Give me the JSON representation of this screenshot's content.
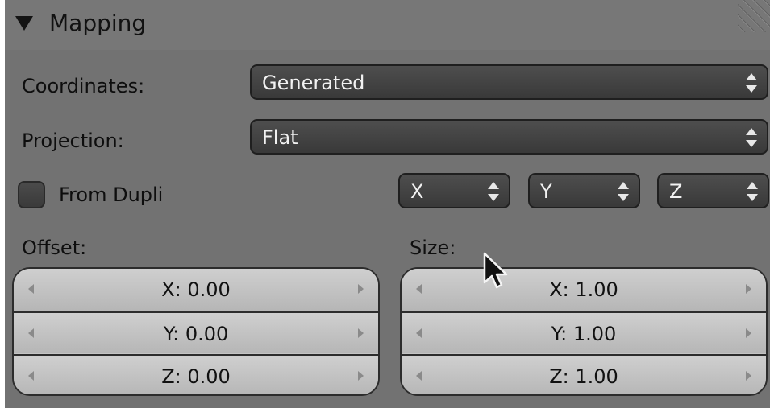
{
  "panel": {
    "title": "Mapping"
  },
  "coordinates": {
    "label": "Coordinates:",
    "value": "Generated"
  },
  "projection": {
    "label": "Projection:",
    "value": "Flat"
  },
  "from_dupli": {
    "label": "From Dupli",
    "checked": false
  },
  "axis_selectors": [
    "X",
    "Y",
    "Z"
  ],
  "offset": {
    "label": "Offset:",
    "rows": [
      "X: 0.00",
      "Y: 0.00",
      "Z: 0.00"
    ]
  },
  "size": {
    "label": "Size:",
    "rows": [
      "X: 1.00",
      "Y: 1.00",
      "Z: 1.00"
    ]
  },
  "icons": {
    "collapse": "triangle-down-icon",
    "resize": "resize-grip-icon",
    "pointer": "mouse-cursor-icon"
  }
}
